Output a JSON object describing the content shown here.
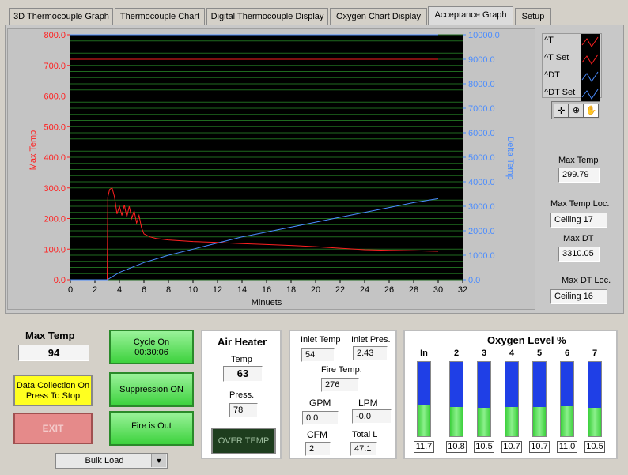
{
  "tabs": [
    {
      "label": "3D Thermocouple Graph"
    },
    {
      "label": "Thermocouple Chart"
    },
    {
      "label": "Digital Thermocouple Display"
    },
    {
      "label": "Oxygen Chart Display"
    },
    {
      "label": "Acceptance Graph"
    },
    {
      "label": "Setup"
    }
  ],
  "legend": {
    "items": [
      {
        "label": "^T"
      },
      {
        "label": "^T Set"
      },
      {
        "label": "^DT"
      },
      {
        "label": "^DT Set"
      }
    ]
  },
  "colors": {
    "red": "#ff2020",
    "blue": "#4a8cff",
    "plot_bg": "#000000",
    "grid": "#1f6a1f"
  },
  "chart_data": {
    "type": "line",
    "xlabel": "Minuets",
    "ylabel_left": "Max Temp",
    "ylabel_right": "Delta Temp",
    "x_ticks": [
      "0",
      "2",
      "4",
      "6",
      "8",
      "10",
      "12",
      "14",
      "16",
      "18",
      "20",
      "22",
      "24",
      "26",
      "28",
      "30",
      "32"
    ],
    "y_left_ticks": [
      "0.0",
      "100.0",
      "200.0",
      "300.0",
      "400.0",
      "500.0",
      "600.0",
      "700.0",
      "800.0"
    ],
    "y_right_ticks": [
      "0.0",
      "1000.0",
      "2000.0",
      "3000.0",
      "4000.0",
      "5000.0",
      "6000.0",
      "7000.0",
      "8000.0",
      "9000.0",
      "10000.0"
    ],
    "xlim": [
      0,
      32
    ],
    "ylim_left": [
      0,
      800
    ],
    "ylim_right": [
      0,
      10000
    ],
    "series": [
      {
        "name": "^T",
        "axis": "left",
        "x": [
          0,
          3,
          3.05,
          3.2,
          3.4,
          3.6,
          3.8,
          4,
          4.2,
          4.4,
          4.6,
          4.8,
          5,
          5.2,
          5.4,
          5.6,
          5.8,
          6,
          6.5,
          7,
          8,
          10,
          12,
          14,
          16,
          18,
          20,
          22,
          24,
          26,
          28,
          30
        ],
        "y": [
          0,
          0,
          270,
          295,
          300,
          270,
          215,
          240,
          210,
          245,
          205,
          240,
          200,
          225,
          185,
          210,
          170,
          150,
          140,
          135,
          130,
          125,
          122,
          118,
          115,
          112,
          108,
          103,
          98,
          96,
          95,
          93
        ]
      },
      {
        "name": "^T Set",
        "axis": "left",
        "x": [
          0,
          30
        ],
        "y": [
          720,
          720
        ]
      },
      {
        "name": "^DT",
        "axis": "right",
        "x": [
          0,
          3,
          4,
          6,
          8,
          10,
          12,
          14,
          16,
          18,
          20,
          22,
          24,
          26,
          28,
          30
        ],
        "y": [
          0,
          0,
          300,
          700,
          1000,
          1250,
          1500,
          1750,
          1950,
          2150,
          2350,
          2550,
          2750,
          2950,
          3150,
          3310
        ]
      },
      {
        "name": "^DT Set",
        "axis": "right",
        "x": [
          0,
          30
        ],
        "y": [
          10000,
          10000
        ]
      }
    ]
  },
  "readouts": {
    "max_temp_label": "Max Temp",
    "max_temp": "299.79",
    "max_temp_loc_label": "Max Temp Loc.",
    "max_temp_loc": "Ceiling 17",
    "max_dt_label": "Max DT",
    "max_dt": "3310.05",
    "max_dt_loc_label": "Max DT Loc.",
    "max_dt_loc": "Ceiling 16"
  },
  "bottom": {
    "max_temp_label": "Max Temp",
    "max_temp": "94",
    "data_collection": "Data Collection On\nPress To Stop",
    "exit": "EXIT",
    "bulk_load": "Bulk Load",
    "cycle_on": "Cycle On\n00:30:06",
    "suppression": "Suppression ON",
    "fire_out": "Fire is Out"
  },
  "air_heater": {
    "title": "Air Heater",
    "temp_label": "Temp",
    "temp": "63",
    "press_label": "Press.",
    "press": "78",
    "over_temp": "OVER TEMP"
  },
  "inlet": {
    "inlet_temp_label": "Inlet Temp",
    "inlet_temp": "54",
    "inlet_pres_label": "Inlet Pres.",
    "inlet_pres": "2.43",
    "fire_temp_label": "Fire Temp.",
    "fire_temp": "276",
    "gpm_label": "GPM",
    "gpm": "0.0",
    "lpm_label": "LPM",
    "lpm": "-0.0",
    "cfm_label": "CFM",
    "cfm": "2",
    "total_label": "Total L",
    "total": "47.1"
  },
  "oxygen": {
    "title": "Oxygen Level %",
    "columns": [
      {
        "label": "In",
        "value": "11.7",
        "level": 0.42
      },
      {
        "label": "2",
        "value": "10.8",
        "level": 0.39
      },
      {
        "label": "3",
        "value": "10.5",
        "level": 0.38
      },
      {
        "label": "4",
        "value": "10.7",
        "level": 0.39
      },
      {
        "label": "5",
        "value": "10.7",
        "level": 0.39
      },
      {
        "label": "6",
        "value": "11.0",
        "level": 0.4
      },
      {
        "label": "7",
        "value": "10.5",
        "level": 0.38
      }
    ]
  }
}
